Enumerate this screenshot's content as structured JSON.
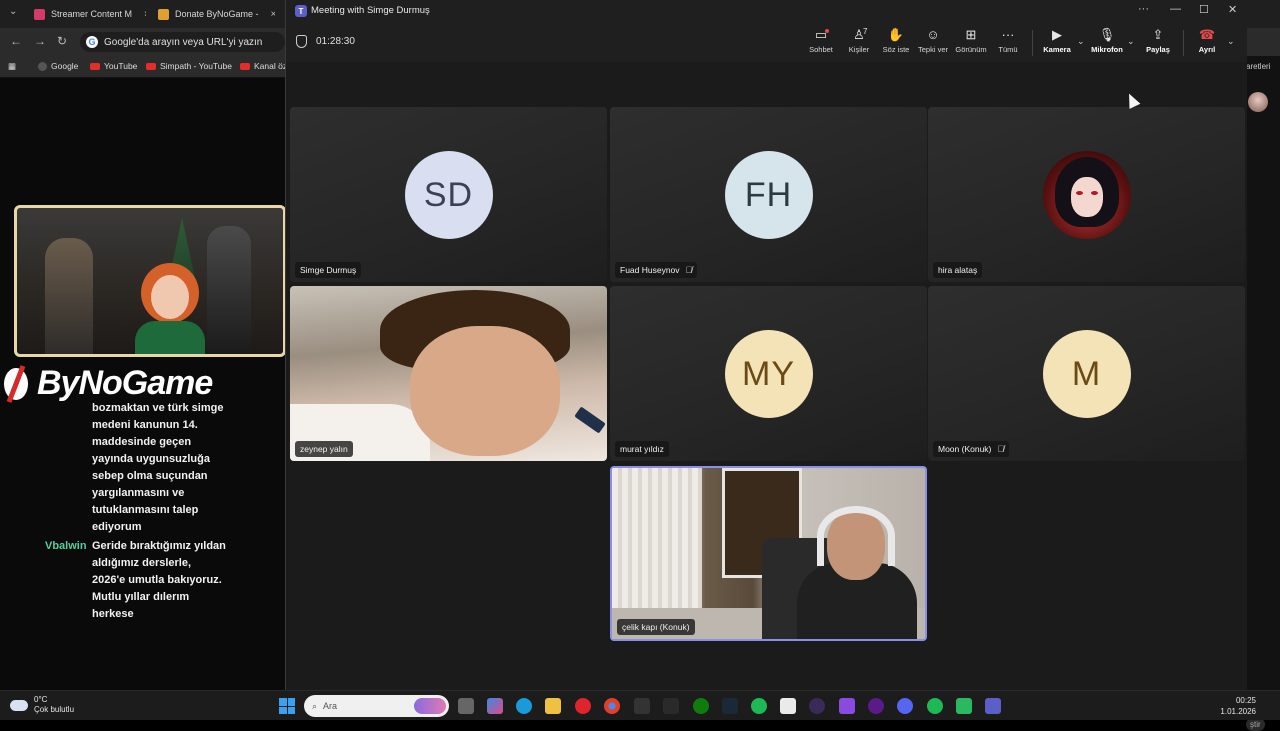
{
  "browser": {
    "tabs": [
      {
        "label": "Streamer Content M",
        "close": "×",
        "color": "#d63a6a"
      },
      {
        "label": "Donate ByNoGame -",
        "close": "×",
        "color": "#e0a030"
      }
    ],
    "omnibox_placeholder": "Google'da arayın veya URL'yi yazın",
    "bookmarks": [
      "Google",
      "YouTube",
      "Simpath - YouTube",
      "Kanal öz"
    ],
    "right_partial_text": "aretleri",
    "right_bottom_partial": "ştir"
  },
  "overlay": {
    "brand": "ByNoGame",
    "chat": [
      {
        "user": "",
        "lines": [
          "bozmaktan ve türk simge",
          "medeni kanunun 14.",
          "maddesinde geçen",
          "yayında uygunsuzluğa",
          "sebep olma suçundan",
          "yargılanmasını ve",
          "tutuklanmasını talep",
          "ediyorum"
        ]
      },
      {
        "user": "Vbalwin",
        "lines": [
          "Geride bıraktığımız yıldan",
          "aldığımız derslerle,",
          "2026'e umutla bakıyoruz.",
          "Mutlu yıllar dılerım",
          "herkese"
        ]
      }
    ]
  },
  "teams": {
    "window_title": "Meeting with Simge Durmuş",
    "timer": "01:28:30",
    "controls": [
      {
        "label": "Sohbet",
        "icon": "chat-icon"
      },
      {
        "label": "Kişiler",
        "icon": "people-icon",
        "count": "7"
      },
      {
        "label": "Söz iste",
        "icon": "raise-hand-icon"
      },
      {
        "label": "Tepki ver",
        "icon": "reaction-icon"
      },
      {
        "label": "Görünüm",
        "icon": "view-icon"
      },
      {
        "label": "Tümü",
        "icon": "more-icon"
      },
      {
        "label": "Kamera",
        "icon": "camera-off-icon"
      },
      {
        "label": "Mikrofon",
        "icon": "mic-icon"
      },
      {
        "label": "Paylaş",
        "icon": "share-icon"
      },
      {
        "label": "Ayrıl",
        "icon": "leave-icon"
      }
    ],
    "participants": [
      {
        "name": "Simge Durmuş",
        "initials": "SD",
        "muted": false
      },
      {
        "name": "Fuad Huseynov",
        "initials": "FH",
        "muted": true
      },
      {
        "name": "hira alataş",
        "initials": "",
        "muted": false
      },
      {
        "name": "zeynep yalın",
        "initials": "",
        "muted": false
      },
      {
        "name": "murat yıldız",
        "initials": "MY",
        "muted": false
      },
      {
        "name": "Moon (Konuk)",
        "initials": "M",
        "muted": true
      },
      {
        "name": "çelik kapı (Konuk)",
        "initials": "",
        "muted": false
      }
    ],
    "colors": {
      "accent": "#5b5fc7",
      "leave": "#e64a4a"
    }
  },
  "taskbar": {
    "weather_temp": "0°C",
    "weather_desc": "Çok bulutlu",
    "search_placeholder": "Ara",
    "time": "00:25",
    "date": "1.01.2026"
  }
}
